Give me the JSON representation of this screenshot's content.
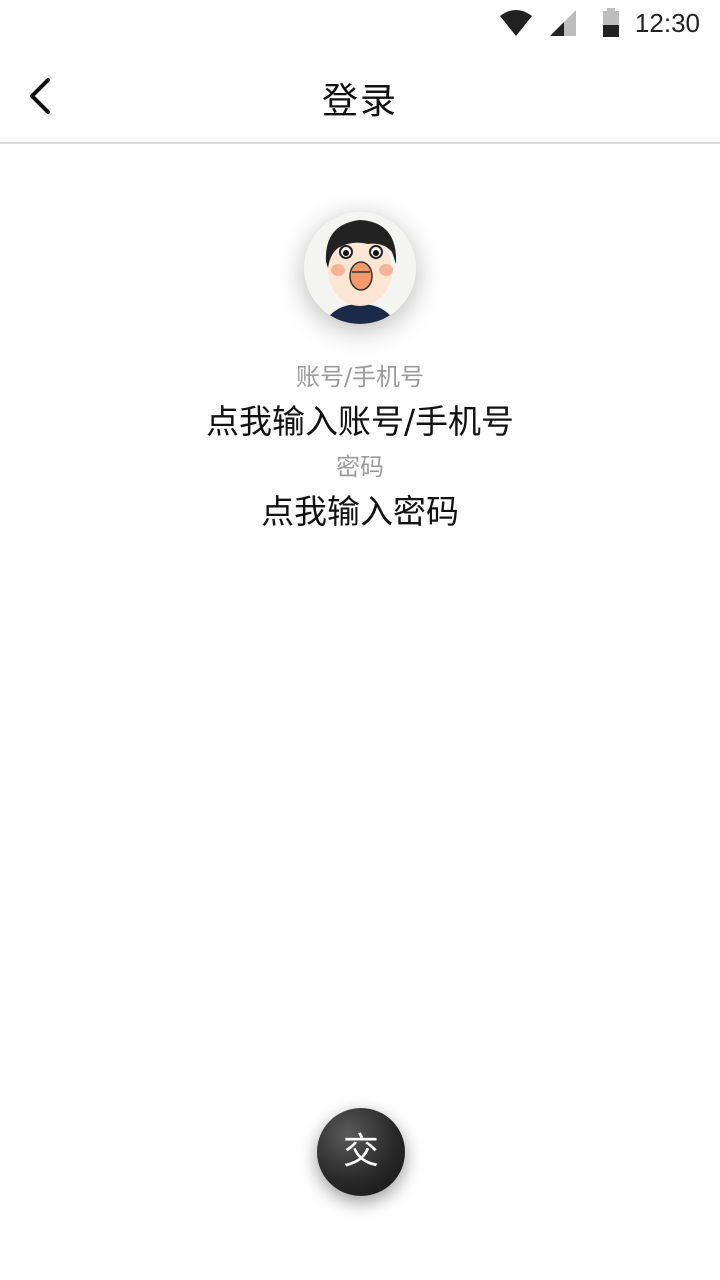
{
  "status_bar": {
    "time": "12:30",
    "icons": [
      "wifi-icon",
      "signal-icon",
      "battery-icon"
    ]
  },
  "header": {
    "title": "登录",
    "back_icon": "chevron-left-icon"
  },
  "avatar": {
    "icon": "cartoon-avatar"
  },
  "form": {
    "account_label": "账号/手机号",
    "account_placeholder": "点我输入账号/手机号",
    "password_label": "密码",
    "password_placeholder": "点我输入密码"
  },
  "submit": {
    "label": "交"
  },
  "colors": {
    "label_gray": "#9b9b9b",
    "button_dark": "#2a2a2a",
    "divider": "#dcdcdc"
  }
}
